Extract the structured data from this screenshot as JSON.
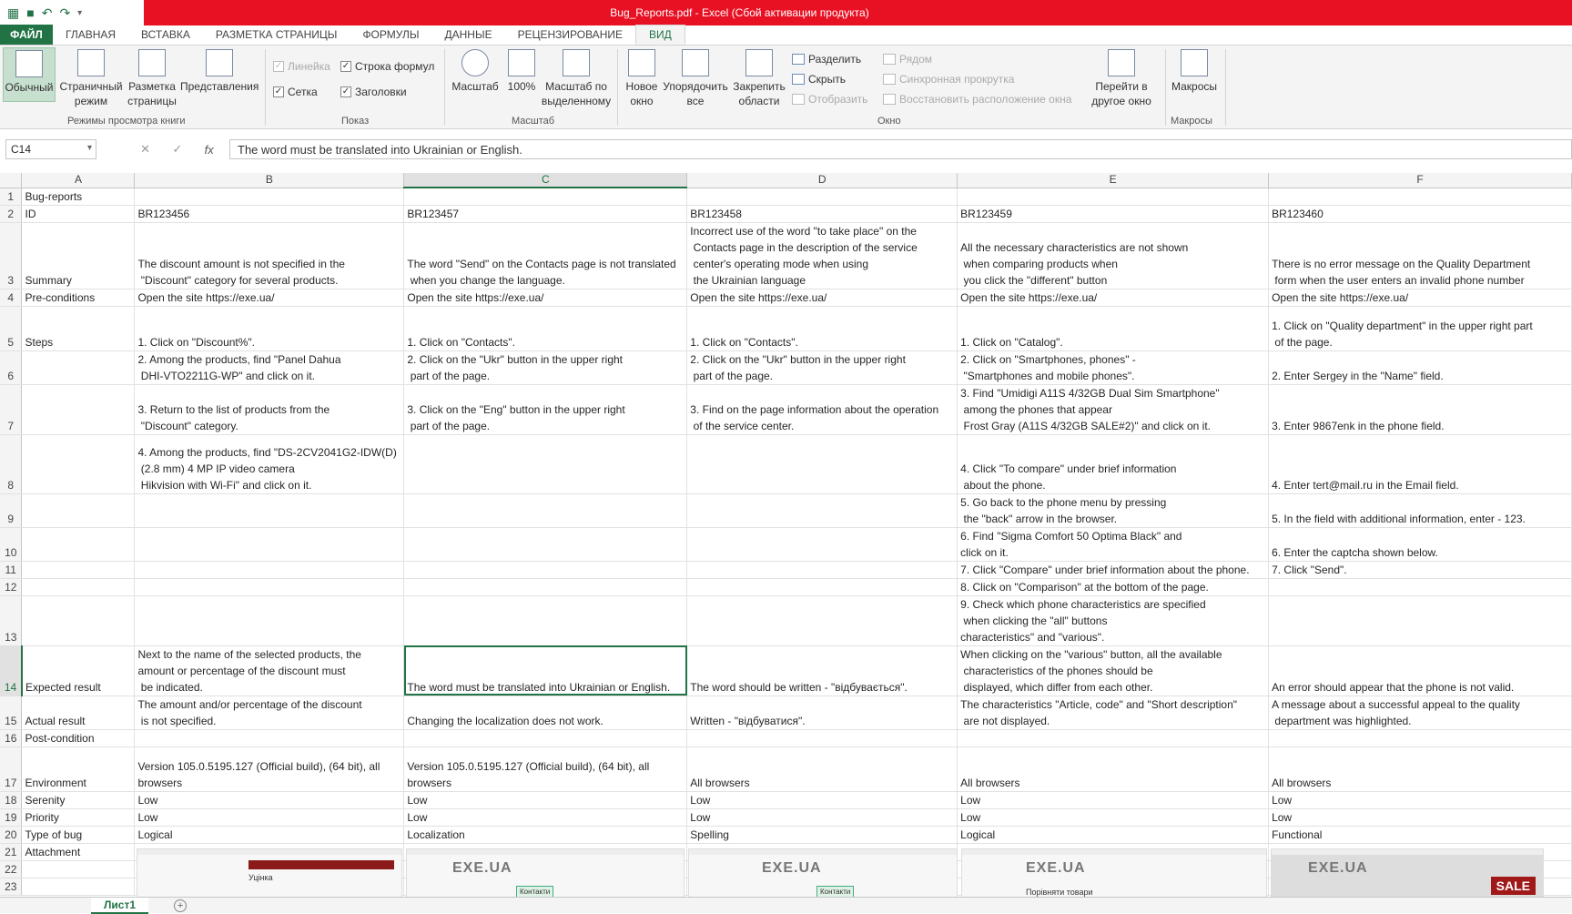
{
  "window": {
    "title": "Bug_Reports.pdf -  Excel (Сбой активации продукта)"
  },
  "tabs": [
    "ФАЙЛ",
    "ГЛАВНАЯ",
    "ВСТАВКА",
    "РАЗМЕТКА СТРАНИЦЫ",
    "ФОРМУЛЫ",
    "ДАННЫЕ",
    "РЕЦЕНЗИРОВАНИЕ",
    "ВИД"
  ],
  "ribbon": {
    "views": {
      "normal": "Обычный",
      "pagebreak": "Страничный режим",
      "pagelayout": "Разметка страницы",
      "custom": "Представления",
      "group": "Режимы просмотра книги"
    },
    "show": {
      "ruler": "Линейка",
      "formula_bar": "Строка формул",
      "grid": "Сетка",
      "headers": "Заголовки",
      "group": "Показ"
    },
    "zoom": {
      "zoom": "Масштаб",
      "zoom100": "100%",
      "selection": "Масштаб по выделенному",
      "group": "Масштаб"
    },
    "window": {
      "new": "Новое окно",
      "arrange": "Упорядочить все",
      "freeze": "Закрепить области",
      "split": "Разделить",
      "hide": "Скрыть",
      "unhide": "Отобразить",
      "side": "Рядом",
      "sync": "Синхронная прокрутка",
      "reset": "Восстановить расположение окна",
      "switch": "Перейти в другое окно",
      "group": "Окно"
    },
    "macros": {
      "macros": "Макросы",
      "group": "Макросы"
    }
  },
  "formula_bar": {
    "namebox": "C14",
    "fx": "fx",
    "content": "The word must be translated into Ukrainian or English."
  },
  "columns": [
    "A",
    "B",
    "C",
    "D",
    "E",
    "F"
  ],
  "rows": [
    {
      "n": "1",
      "cells": [
        "Bug-reports",
        "",
        "",
        "",
        "",
        ""
      ]
    },
    {
      "n": "2",
      "cells": [
        "ID",
        "BR123456",
        "BR123457",
        "BR123458",
        "BR123459",
        "BR123460"
      ]
    },
    {
      "n": "3",
      "cells": [
        "Summary",
        "The discount amount is not specified in the\n \"Discount\" category for several products.",
        "The word \"Send\" on the Contacts page is not translated\n when you change the language.",
        "Incorrect use of the word \"to take place\" on the\n Contacts page in the description of the service\n center's operating mode when using\n the Ukrainian language",
        "All the necessary characteristics are not shown\n when comparing products when\n you click the \"different\" button",
        "There is no error message on the Quality Department\n form when the user enters an invalid phone number"
      ]
    },
    {
      "n": "4",
      "cells": [
        "Pre-conditions",
        "Open the site https://exe.ua/",
        "Open the site https://exe.ua/",
        "Open the site https://exe.ua/",
        "Open the site https://exe.ua/",
        "Open the site https://exe.ua/"
      ]
    },
    {
      "n": "5",
      "cells": [
        "Steps",
        "1. Click on \"Discount%\".",
        "1. Click on \"Contacts\".",
        "1. Click on \"Contacts\".",
        "1. Click on \"Catalog\".",
        "1. Click on \"Quality department\" in the upper right part\n of the page."
      ]
    },
    {
      "n": "6",
      "cells": [
        "",
        "2. Among the products, find \"Panel Dahua\n DHI-VTO2211G-WP\" and click on it.",
        "2. Click on the \"Ukr\" button in the upper right\n part of the page.",
        "2. Click on the \"Ukr\" button in the upper right\n part of the page.",
        "2. Click on \"Smartphones, phones\" -\n \"Smartphones and mobile phones\".",
        "2. Enter Sergey in the \"Name\" field."
      ]
    },
    {
      "n": "7",
      "cells": [
        "",
        "3. Return to the list of products from the\n \"Discount\" category.",
        "3. Click on the \"Eng\" button in the upper right\n part of the page.",
        "3. Find on the page information about the operation\n of the service center.",
        "3. Find \"Umidigi A11S 4/32GB Dual Sim Smartphone\"\n among the phones that appear\n Frost Gray (A11S 4/32GB SALE#2)\" and click on it.",
        "3. Enter 9867enk in the phone field."
      ]
    },
    {
      "n": "8",
      "cells": [
        "",
        "4. Among the products, find \"DS-2CV2041G2-IDW(D)\n (2.8 mm) 4 MP IP video camera\n Hikvision with Wi-Fi\" and click on it.",
        "",
        "",
        "4. Click \"To compare\" under brief information\n about the phone.",
        "4. Enter tert@mail.ru in the Email field."
      ]
    },
    {
      "n": "9",
      "cells": [
        "",
        "",
        "",
        "",
        "5. Go back to the phone menu by pressing\n the \"back\" arrow in the browser.",
        "5. In the field with additional information, enter - 123."
      ]
    },
    {
      "n": "10",
      "cells": [
        "",
        "",
        "",
        "",
        "6. Find \"Sigma Comfort 50 Optima Black\" and\nclick on it.",
        "6. Enter the captcha shown below."
      ]
    },
    {
      "n": "11",
      "cells": [
        "",
        "",
        "",
        "",
        "7. Click \"Compare\" under brief information about the phone.",
        "7. Click \"Send\"."
      ]
    },
    {
      "n": "12",
      "cells": [
        "",
        "",
        "",
        "",
        "8. Click on \"Comparison\" at the bottom of the page.",
        ""
      ]
    },
    {
      "n": "13",
      "cells": [
        "",
        "",
        "",
        "",
        "9. Check which phone characteristics are specified\n when clicking the \"all\" buttons\ncharacteristics\" and \"various\".",
        ""
      ]
    },
    {
      "n": "14",
      "cells": [
        "Expected result",
        "Next to the name of the selected products, the\namount or percentage of the discount must\n be indicated.",
        "The word must be translated into Ukrainian or English.",
        "The word should be written - \"відбувається\".",
        "When clicking on the \"various\" button, all the available\n characteristics of the phones should be\n displayed, which differ from each other.",
        "An error should appear that the phone is not valid."
      ]
    },
    {
      "n": "15",
      "cells": [
        "Actual result",
        "The amount and/or percentage of the discount\n is not specified.",
        "Changing the localization does not work.",
        "Written - \"відбуватися\".",
        "The characteristics \"Article, code\" and \"Short description\"\n are not displayed.",
        "A message about a successful appeal to the quality\n department was highlighted."
      ]
    },
    {
      "n": "16",
      "cells": [
        "Post-condition",
        "",
        "",
        "",
        "",
        ""
      ]
    },
    {
      "n": "17",
      "cells": [
        "Environment",
        "Version 105.0.5195.127 (Official build), (64 bit), all\nbrowsers",
        "Version 105.0.5195.127 (Official build), (64 bit), all\nbrowsers",
        "All browsers",
        "All browsers",
        "All browsers"
      ]
    },
    {
      "n": "18",
      "cells": [
        "Serenity",
        "Low",
        "Low",
        "Low",
        "Low",
        "Low"
      ]
    },
    {
      "n": "19",
      "cells": [
        "Priority",
        "Low",
        "Low",
        "Low",
        "Low",
        "Low"
      ]
    },
    {
      "n": "20",
      "cells": [
        "Type of bug",
        "Logical",
        "Localization",
        "Spelling",
        "Logical",
        "Functional"
      ]
    },
    {
      "n": "21",
      "cells": [
        "Attachment",
        "",
        "",
        "",
        "",
        ""
      ]
    },
    {
      "n": "22",
      "cells": [
        "",
        "",
        "",
        "",
        "",
        ""
      ]
    },
    {
      "n": "23",
      "cells": [
        "",
        "",
        "",
        "",
        "",
        ""
      ]
    }
  ],
  "row_lines": [
    1,
    1,
    4,
    1,
    3,
    2,
    3,
    4,
    2,
    2,
    1,
    1,
    3,
    3,
    2,
    1,
    3,
    1,
    1,
    1,
    1,
    1,
    1
  ],
  "attachments": [
    {
      "label": "Уцінка"
    },
    {
      "label": "EXE.UA",
      "btn": "Контакти"
    },
    {
      "label": "EXE.UA",
      "btn": "Контакти"
    },
    {
      "label": "EXE.UA",
      "btn": "Порівняти товари"
    },
    {
      "label": "EXE.UA",
      "btn": "SALE"
    }
  ],
  "sheet": {
    "tab": "Лист1",
    "add": "+"
  },
  "colors": {
    "accent": "#217346",
    "title_bg": "#e81123"
  }
}
